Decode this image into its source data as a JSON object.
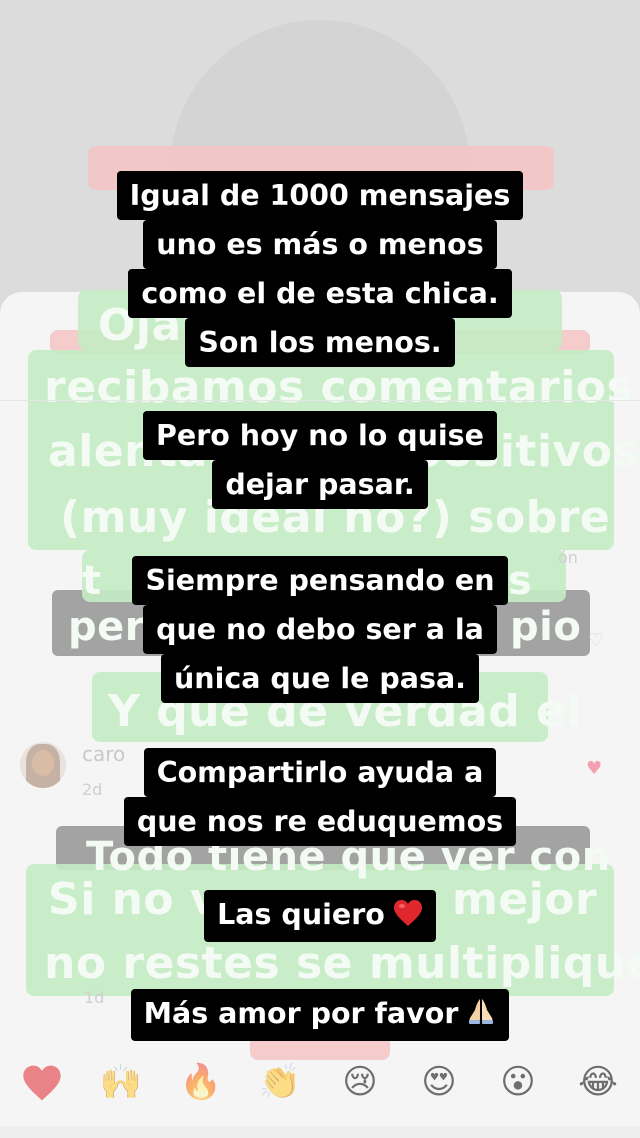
{
  "story": {
    "text_overlay": [
      {
        "lines": [
          "Igual de 1000 mensajes",
          "uno es más o menos",
          "como el de esta chica.",
          "Son los menos."
        ]
      },
      {
        "lines": [
          "Pero hoy no lo quise",
          "dejar pasar."
        ]
      },
      {
        "lines": [
          "Siempre pensando en",
          "que no debo ser a la",
          "única que le pasa."
        ]
      },
      {
        "lines": [
          "Compartirlo ayuda a",
          "que nos re eduquemos"
        ]
      },
      {
        "lines": [
          "Las quiero"
        ],
        "emoji": "red-heart"
      },
      {
        "lines": [
          "Más amor por favor"
        ],
        "emoji": "folded-hands"
      }
    ]
  },
  "background": {
    "sticker_lines": [
      "Ojalá solo",
      "recibamos comentarios",
      "alentadores y positivos",
      "(muy ideal no?) sobre",
      "t",
      "s",
      "per",
      "pio",
      "Y que de verdad el",
      "Todo tiene que ver con",
      "Si no v",
      "mejor",
      "no restes se multiplique"
    ],
    "comments": [
      {
        "username": "caro",
        "time": "2d"
      },
      {
        "time": "1d"
      }
    ],
    "partial_text": "ón"
  },
  "reactions": [
    {
      "name": "heart",
      "glyph": "❤️"
    },
    {
      "name": "raising-hands",
      "glyph": "🙌"
    },
    {
      "name": "fire",
      "glyph": "🔥"
    },
    {
      "name": "clapping-hands",
      "glyph": "👏"
    },
    {
      "name": "crying-face",
      "glyph": "😢"
    },
    {
      "name": "heart-eyes",
      "glyph": "😍"
    },
    {
      "name": "surprised-face",
      "glyph": "😮"
    },
    {
      "name": "tears-of-joy",
      "glyph": "😂"
    }
  ],
  "colors": {
    "sticker_green": "#c4ecc4",
    "sticker_pink": "#f4c3c3",
    "text_bg": "#000000",
    "text_fg": "#ffffff",
    "heart_red": "#e0272e",
    "like_pink": "#f2a0b0"
  }
}
